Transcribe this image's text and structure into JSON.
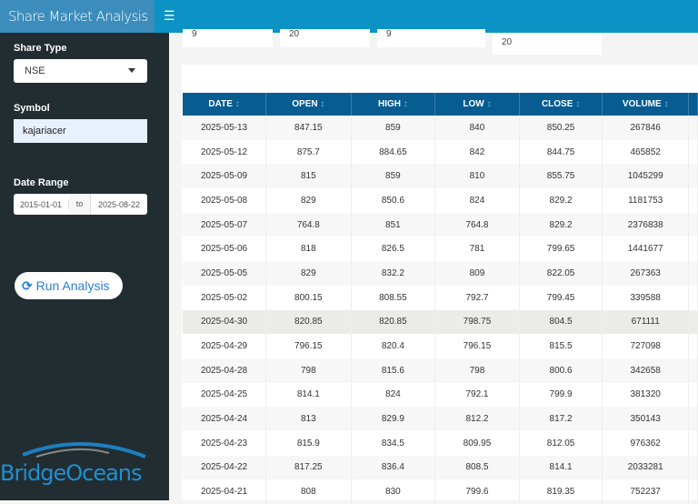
{
  "header": {
    "title": "Share Market Analysis",
    "menu_icon": "hamburger-icon"
  },
  "sidebar": {
    "share_type_label": "Share Type",
    "share_type_value": "NSE",
    "symbol_label": "Symbol",
    "symbol_value": "kajariacer",
    "date_range_label": "Date Range",
    "date_from": "2015-01-01",
    "date_sep": "to",
    "date_to": "2025-08-22",
    "run_label": "Run Analysis",
    "logo_text": "BridgeOceans"
  },
  "value_boxes": [
    "9",
    "20",
    "9",
    "20"
  ],
  "table": {
    "columns": [
      "DATE",
      "OPEN",
      "HIGH",
      "LOW",
      "CLOSE",
      "VOLUME"
    ],
    "sort_icon": "↕",
    "rows": [
      [
        "2025-05-13",
        "847.15",
        "859",
        "840",
        "850.25",
        "267846"
      ],
      [
        "2025-05-12",
        "875.7",
        "884.65",
        "842",
        "844.75",
        "465852"
      ],
      [
        "2025-05-09",
        "815",
        "859",
        "810",
        "855.75",
        "1045299"
      ],
      [
        "2025-05-08",
        "829",
        "850.6",
        "824",
        "829.2",
        "1181753"
      ],
      [
        "2025-05-07",
        "764.8",
        "851",
        "764.8",
        "829.2",
        "2376838"
      ],
      [
        "2025-05-06",
        "818",
        "826.5",
        "781",
        "799.65",
        "1441677"
      ],
      [
        "2025-05-05",
        "829",
        "832.2",
        "809",
        "822.05",
        "267363"
      ],
      [
        "2025-05-02",
        "800.15",
        "808.55",
        "792.7",
        "799.45",
        "339588"
      ],
      [
        "2025-04-30",
        "820.85",
        "820.85",
        "798.75",
        "804.5",
        "671111"
      ],
      [
        "2025-04-29",
        "796.15",
        "820.4",
        "796.15",
        "815.5",
        "727098"
      ],
      [
        "2025-04-28",
        "798",
        "815.6",
        "798",
        "800.6",
        "342658"
      ],
      [
        "2025-04-25",
        "814.1",
        "824",
        "792.1",
        "799.9",
        "381320"
      ],
      [
        "2025-04-24",
        "813",
        "829.9",
        "812.2",
        "817.2",
        "350143"
      ],
      [
        "2025-04-23",
        "815.9",
        "834.5",
        "809.95",
        "812.05",
        "976362"
      ],
      [
        "2025-04-22",
        "817.25",
        "836.4",
        "808.5",
        "814.1",
        "2033281"
      ],
      [
        "2025-04-21",
        "808",
        "830",
        "799.6",
        "819.35",
        "752237"
      ]
    ]
  }
}
